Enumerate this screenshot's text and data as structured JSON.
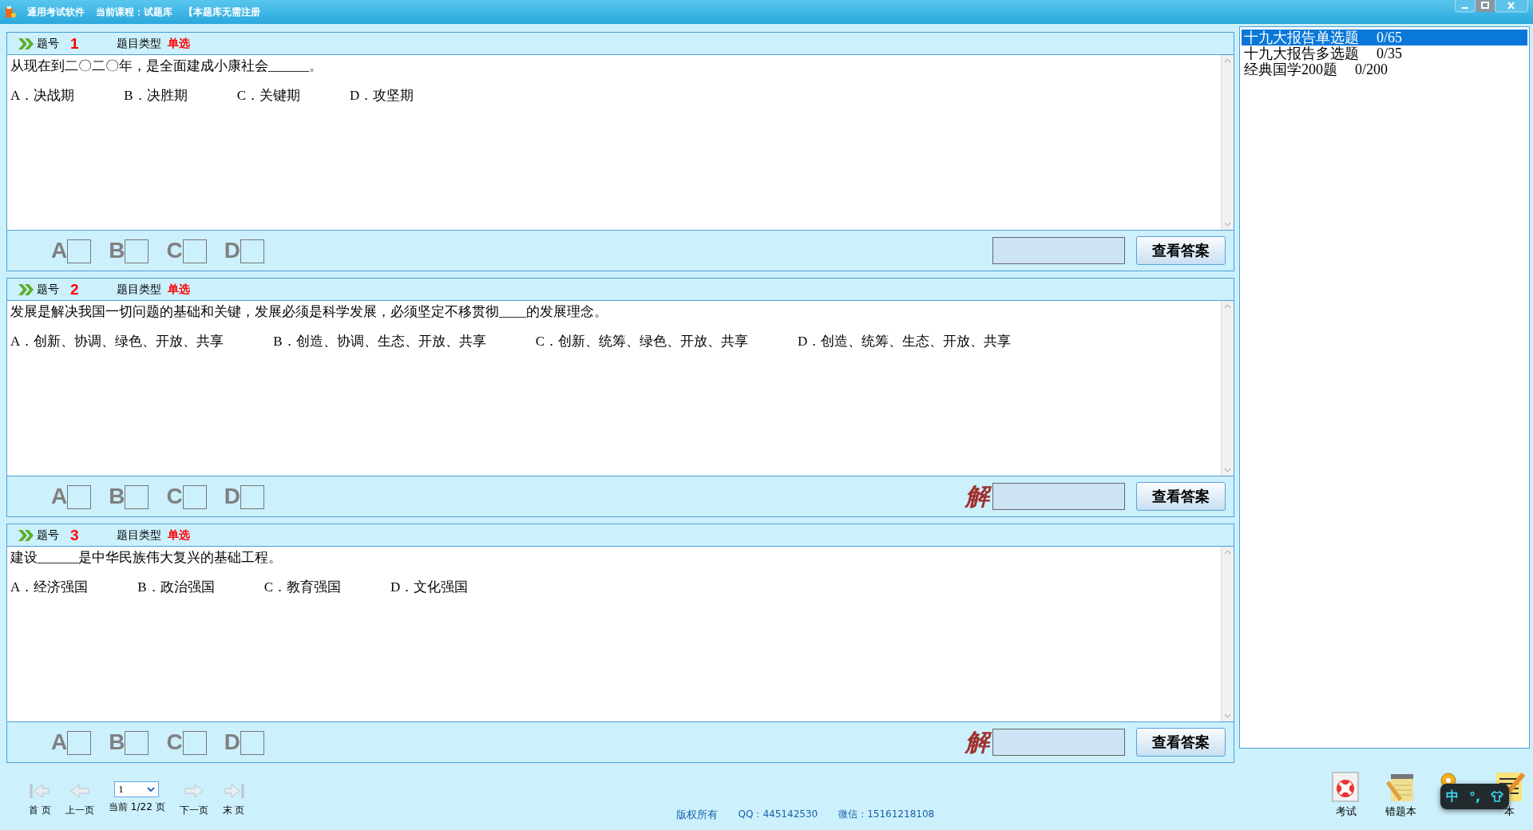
{
  "window": {
    "title_parts": [
      "通用考试软件",
      "当前课程：试题库",
      "【本题库无需注册"
    ]
  },
  "questions": [
    {
      "number_label": "题号",
      "number": "1",
      "type_label": "题目类型",
      "type": "单选",
      "text": "从现在到二〇二〇年，是全面建成小康社会______。",
      "options": [
        "A．决战期",
        "B．决胜期",
        "C．关键期",
        "D．攻坚期"
      ],
      "choices": [
        {
          "letter": "A",
          "checked": false
        },
        {
          "letter": "B",
          "checked": false
        },
        {
          "letter": "C",
          "checked": false
        },
        {
          "letter": "D",
          "checked": false
        }
      ],
      "button": "查看答案"
    },
    {
      "number_label": "题号",
      "number": "2",
      "type_label": "题目类型",
      "type": "单选",
      "text": "发展是解决我国一切问题的基础和关键，发展必须是科学发展，必须坚定不移贯彻____的发展理念。",
      "options": [
        "A．创新、协调、绿色、开放、共享",
        "B．创造、协调、生态、开放、共享",
        "C．创新、统筹、绿色、开放、共享",
        "D．创造、统筹、生态、开放、共享"
      ],
      "choices": [
        {
          "letter": "A",
          "checked": false
        },
        {
          "letter": "B",
          "checked": false
        },
        {
          "letter": "C",
          "checked": false
        },
        {
          "letter": "D",
          "checked": false
        }
      ],
      "hint": "解",
      "button": "查看答案"
    },
    {
      "number_label": "题号",
      "number": "3",
      "type_label": "题目类型",
      "type": "单选",
      "text": "建设______是中华民族伟大复兴的基础工程。",
      "options": [
        "A．经济强国",
        "B．政治强国",
        "C．教育强国",
        "D．文化强国"
      ],
      "choices": [
        {
          "letter": "A",
          "checked": false
        },
        {
          "letter": "B",
          "checked": false
        },
        {
          "letter": "C",
          "checked": false
        },
        {
          "letter": "D",
          "checked": false
        }
      ],
      "hint": "解",
      "button": "查看答案"
    }
  ],
  "courses": [
    {
      "name": "十九大报告单选题",
      "progress": "0/65",
      "selected": true
    },
    {
      "name": "十九大报告多选题",
      "progress": "0/35",
      "selected": false
    },
    {
      "name": "经典国学200题",
      "progress": "0/200",
      "selected": false
    }
  ],
  "nav": [
    {
      "kind": "first",
      "label": "首 页"
    },
    {
      "kind": "prev",
      "label": "上一页"
    },
    {
      "kind": "page",
      "value": "1",
      "label": "当前 1/22 页"
    },
    {
      "kind": "next",
      "label": "下一页"
    },
    {
      "kind": "last",
      "label": "末 页"
    }
  ],
  "footer": [
    "版权所有",
    "QQ：445142530",
    "微信：15161218108"
  ],
  "tools": [
    {
      "kind": "exam",
      "label": "考试"
    },
    {
      "kind": "notebook",
      "label": "错题本"
    },
    {
      "kind": "key"
    },
    {
      "kind": "notepad",
      "label": "本"
    }
  ],
  "ime": {
    "mode": "中",
    "punct": "°,"
  }
}
